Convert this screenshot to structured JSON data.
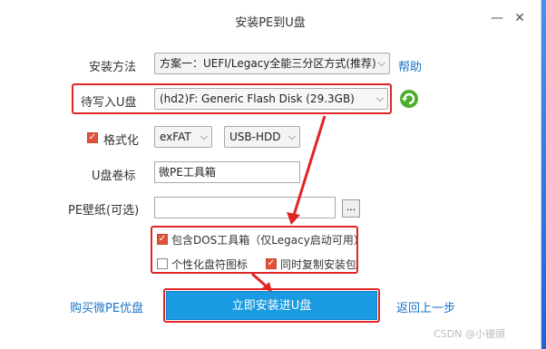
{
  "window": {
    "title": "安装PE到U盘",
    "minimize_glyph": "—",
    "close_glyph": "✕"
  },
  "install_method": {
    "label": "安装方法",
    "value": "方案一：UEFI/Legacy全能三分区方式(推荐)",
    "help": "帮助"
  },
  "target_disk": {
    "label": "待写入U盘",
    "value": "(hd2)F: Generic Flash Disk (29.3GB)",
    "refresh_icon": "refresh-icon"
  },
  "format": {
    "label": "格式化",
    "checked": true,
    "filesystem": "exFAT",
    "mode": "USB-HDD"
  },
  "volume_label": {
    "label": "U盘卷标",
    "value": "微PE工具箱"
  },
  "wallpaper": {
    "label": "PE壁纸(可选)",
    "value": "",
    "browse": "..."
  },
  "options": [
    {
      "label": "包含DOS工具箱（仅Legacy启动可用）",
      "checked": true
    },
    {
      "label": "个性化盘符图标",
      "checked": false
    },
    {
      "label": "同时复制安装包",
      "checked": true
    }
  ],
  "footer": {
    "buy_link": "购买微PE优盘",
    "install_button": "立即安装进U盘",
    "back_link": "返回上一步"
  },
  "watermark": "CSDN @小镘頭",
  "colors": {
    "highlight_red": "#e02525",
    "install_blue": "#1a9ae0",
    "link_blue": "#1a73c8"
  }
}
